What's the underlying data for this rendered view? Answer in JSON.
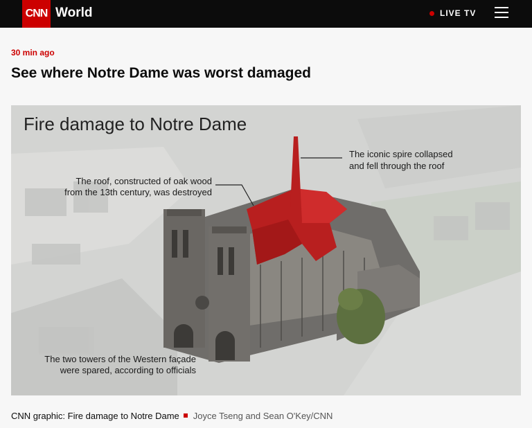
{
  "header": {
    "logo_text": "CNN",
    "section": "World",
    "live_label": "LIVE TV",
    "menu_icon": "hamburger-menu-icon",
    "accent": "#cc0000"
  },
  "article": {
    "timestamp": "30 min ago",
    "headline": "See where Notre Dame was worst damaged"
  },
  "graphic": {
    "title": "Fire damage to Notre Dame",
    "annotations": {
      "spire": [
        "The iconic spire collapsed",
        "and fell through the roof"
      ],
      "roof": [
        "The roof, constructed of oak wood",
        "from the 13th century, was destroyed"
      ],
      "towers": [
        "The two towers of the Western façade",
        "were spared, according to officials"
      ]
    },
    "highlight_color": "#b81f1f"
  },
  "caption": {
    "text": "CNN graphic: Fire damage to Notre Dame",
    "credit": "Joyce Tseng and Sean O'Key/CNN"
  }
}
